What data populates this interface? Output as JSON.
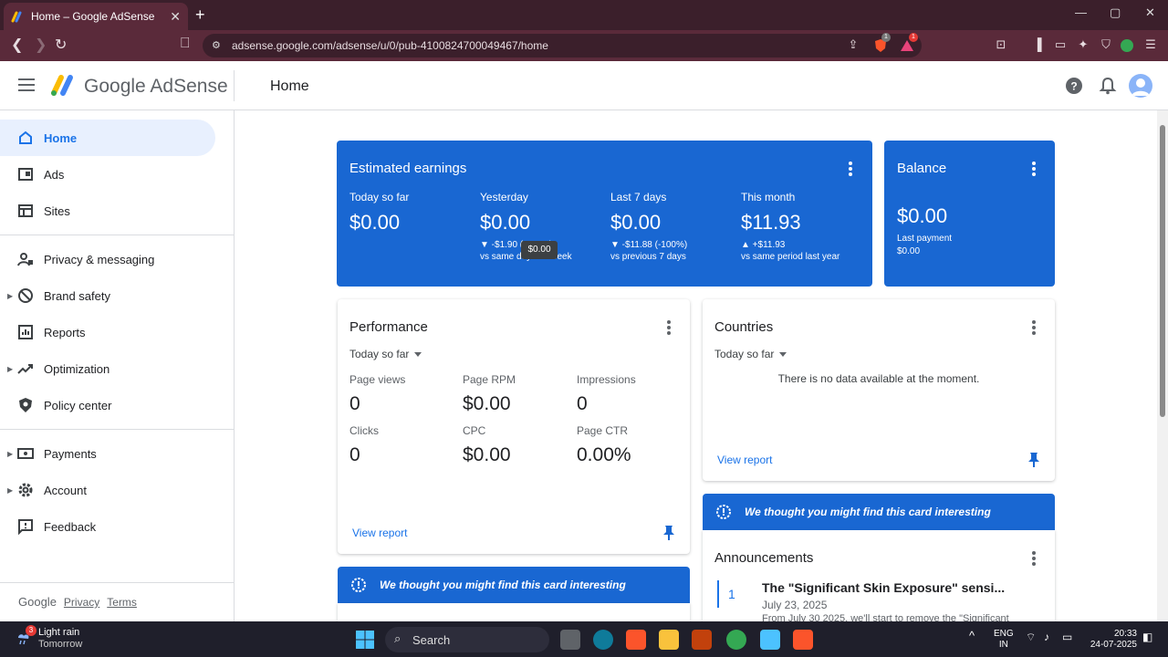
{
  "browser": {
    "tab_title": "Home – Google AdSense",
    "url": "adsense.google.com/adsense/u/0/pub-4100824700049467/home",
    "brave_badge": "1",
    "alert_badge": "1"
  },
  "header": {
    "brand": "Google AdSense",
    "page_title": "Home"
  },
  "sidebar": {
    "items": [
      {
        "label": "Home"
      },
      {
        "label": "Ads"
      },
      {
        "label": "Sites"
      },
      {
        "label": "Privacy & messaging"
      },
      {
        "label": "Brand safety"
      },
      {
        "label": "Reports"
      },
      {
        "label": "Optimization"
      },
      {
        "label": "Policy center"
      },
      {
        "label": "Payments"
      },
      {
        "label": "Account"
      },
      {
        "label": "Feedback"
      }
    ],
    "footer": {
      "google": "Google",
      "privacy": "Privacy",
      "terms": "Terms"
    }
  },
  "earnings": {
    "title": "Estimated earnings",
    "metrics": [
      {
        "label": "Today so far",
        "value": "$0.00",
        "delta": "",
        "compare": ""
      },
      {
        "label": "Yesterday",
        "value": "$0.00",
        "delta": "▼ -$1.90 (-100%)",
        "compare": "vs same day last week"
      },
      {
        "label": "Last 7 days",
        "value": "$0.00",
        "delta": "▼ -$11.88 (-100%)",
        "compare": "vs previous 7 days"
      },
      {
        "label": "This month",
        "value": "$11.93",
        "delta": "▲ +$11.93",
        "compare": "vs same period last year"
      }
    ],
    "tooltip": "$0.00"
  },
  "balance": {
    "title": "Balance",
    "value": "$0.00",
    "last_payment_label": "Last payment",
    "last_payment_value": "$0.00"
  },
  "performance": {
    "title": "Performance",
    "range": "Today so far",
    "metrics": [
      {
        "label": "Page views",
        "value": "0"
      },
      {
        "label": "Page RPM",
        "value": "$0.00"
      },
      {
        "label": "Impressions",
        "value": "0"
      },
      {
        "label": "Clicks",
        "value": "0"
      },
      {
        "label": "CPC",
        "value": "$0.00"
      },
      {
        "label": "Page CTR",
        "value": "0.00%"
      }
    ],
    "link": "View report"
  },
  "countries": {
    "title": "Countries",
    "range": "Today so far",
    "empty": "There is no data available at the moment.",
    "link": "View report"
  },
  "banner_text": "We thought you might find this card interesting",
  "announcements": {
    "title": "Announcements",
    "number": "1",
    "headline": "The \"Significant Skin Exposure\" sensi...",
    "date": "July 23, 2025",
    "snippet": "From July 30 2025, we'll start to remove the \"Significant"
  },
  "taskbar": {
    "weather_title": "Light rain",
    "weather_sub": "Tomorrow",
    "weather_badge": "3",
    "search": "Search",
    "lang": "ENG",
    "region": "IN",
    "time": "20:33",
    "date": "24-07-2025"
  }
}
